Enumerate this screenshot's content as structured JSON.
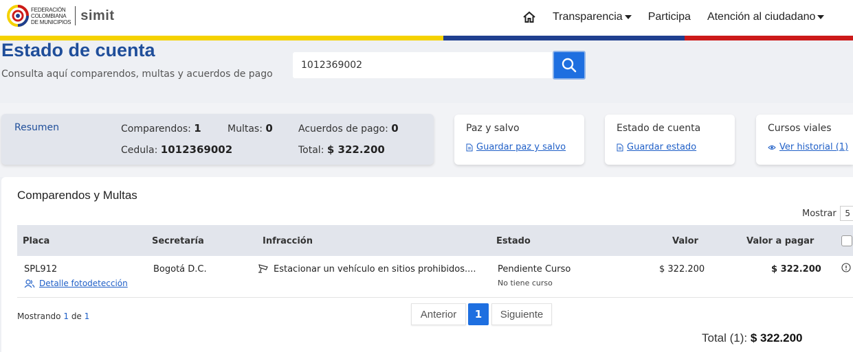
{
  "brand": {
    "logo_lines": [
      "FEDERACIÓN",
      "COLOMBIANA",
      "DE MUNICIPIOS"
    ],
    "app_name": "simit",
    "flag_colors": [
      "#f5d200",
      "#1f3f8f",
      "#cc1a1a"
    ]
  },
  "nav": {
    "home_icon": "home-icon",
    "items": [
      {
        "label": "Transparencia",
        "dropdown": true
      },
      {
        "label": "Participa",
        "dropdown": false
      },
      {
        "label": "Atención al ciudadano",
        "dropdown": true
      }
    ]
  },
  "header": {
    "title": "Estado de cuenta",
    "subtitle": "Consulta aquí comparendos, multas y acuerdos de pago",
    "search_value": "1012369002",
    "search_icon": "search-icon"
  },
  "summary": {
    "heading": "Resumen",
    "comparendos_label": "Comparendos:",
    "comparendos_value": "1",
    "multas_label": "Multas:",
    "multas_value": "0",
    "acuerdos_label": "Acuerdos de pago:",
    "acuerdos_value": "0",
    "cedula_label": "Cedula:",
    "cedula_value": "1012369002",
    "total_label": "Total:",
    "total_value": "$ 322.200"
  },
  "cards": [
    {
      "title": "Paz y salvo",
      "link": "Guardar paz y salvo",
      "icon": "document-icon"
    },
    {
      "title": "Estado de cuenta",
      "link": "Guardar estado",
      "icon": "document-icon"
    },
    {
      "title": "Cursos viales",
      "link": "Ver historial (1)",
      "icon": "eye-icon"
    }
  ],
  "table": {
    "title": "Comparendos y Multas",
    "mostrar_label": "Mostrar",
    "mostrar_value": "5",
    "columns": [
      "Placa",
      "Secretaría",
      "Infracción",
      "Estado",
      "Valor",
      "Valor a pagar"
    ],
    "rows": [
      {
        "placa": "SPL912",
        "detail_link": "Detalle fotodetección",
        "secretaria": "Bogotá D.C.",
        "infraccion": "Estacionar un vehículo en sitios prohibidos....",
        "estado": "Pendiente Curso",
        "estado_sub": "No tiene curso",
        "valor": "$ 322.200",
        "valor_pagar": "$ 322.200"
      }
    ],
    "showing_prefix": "Mostrando",
    "showing_from": "1",
    "showing_mid": "de",
    "showing_total": "1",
    "pagination": {
      "prev": "Anterior",
      "current": "1",
      "next": "Siguiente"
    },
    "total_label": "Total (1):",
    "total_value": "$ 322.200"
  }
}
